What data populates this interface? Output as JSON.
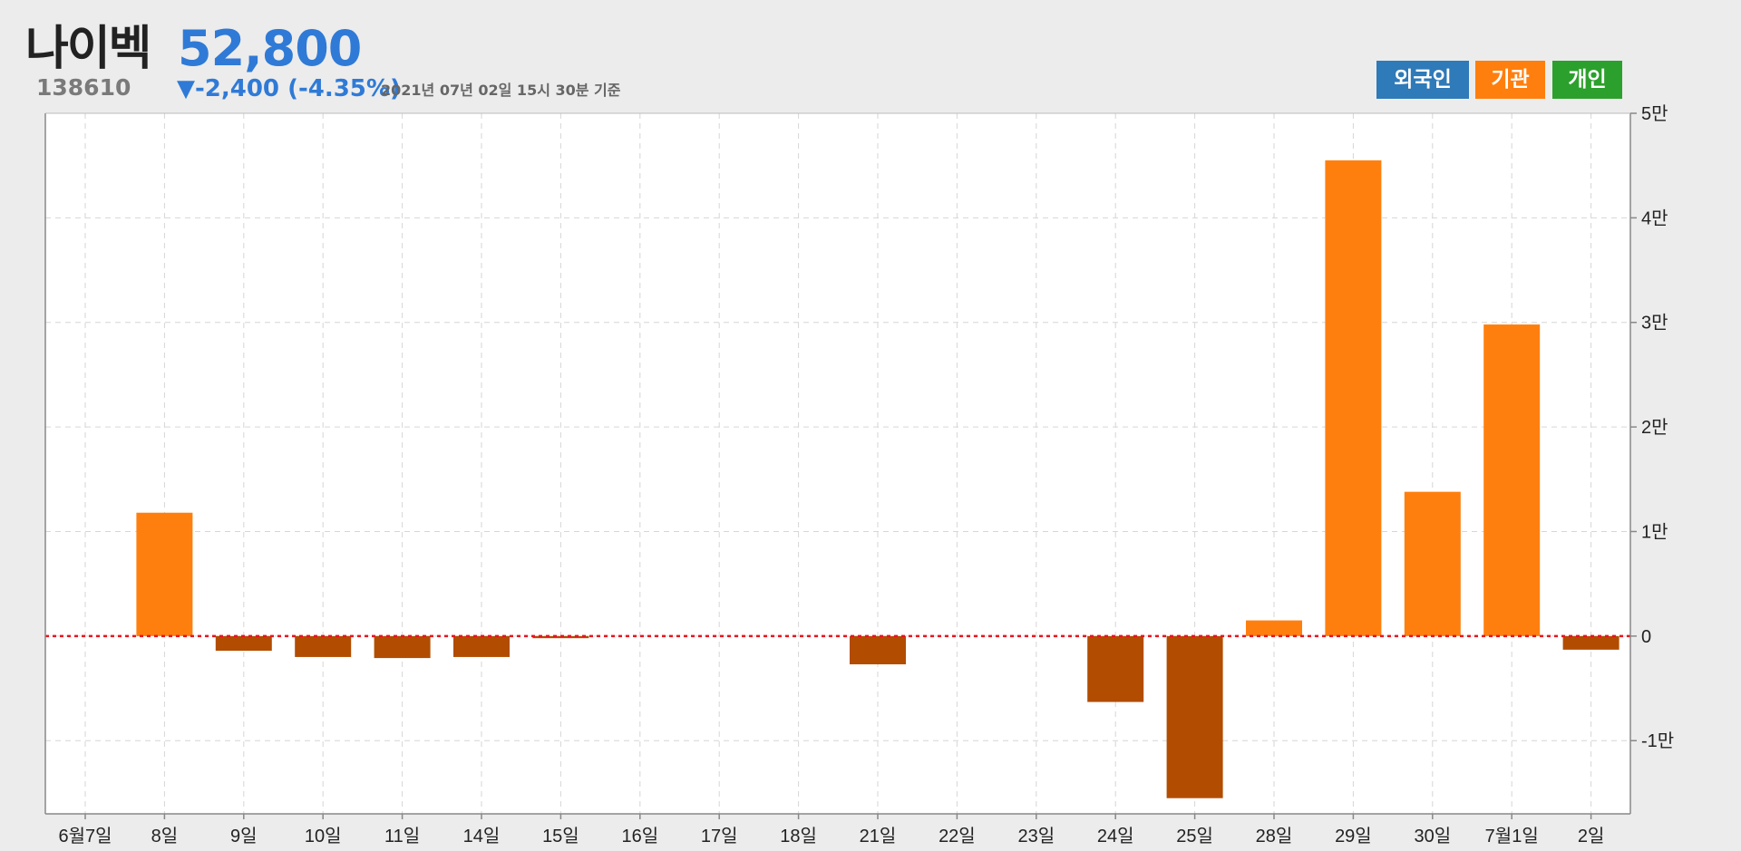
{
  "header": {
    "name": "나이벡",
    "price": "52,800",
    "code": "138610",
    "change": "▼-2,400 (-4.35%)",
    "timestamp": "2021년 07년 02일 15시 30분 기준"
  },
  "legend": {
    "foreign": "외국인",
    "institution": "기관",
    "individual": "개인"
  },
  "colors": {
    "positive": "#ff7f0e",
    "negative": "#b24c00",
    "foreign": "#2f7ab8",
    "individual": "#2ca02c",
    "zero_line": "#e8141e",
    "price": "#2f7ad6"
  },
  "chart_data": {
    "type": "bar",
    "categories": [
      "6월7일",
      "8일",
      "9일",
      "10일",
      "11일",
      "14일",
      "15일",
      "16일",
      "17일",
      "18일",
      "21일",
      "22일",
      "23일",
      "24일",
      "25일",
      "28일",
      "29일",
      "30일",
      "7월1일",
      "2일"
    ],
    "series": [
      {
        "values": [
          0,
          11800,
          -1400,
          -2000,
          -2100,
          -2000,
          -200,
          0,
          0,
          0,
          -2700,
          0,
          0,
          -6300,
          -15500,
          1500,
          45500,
          13800,
          29800,
          -1300
        ]
      }
    ],
    "ylim": [
      -17000,
      50000
    ],
    "yticks": [
      {
        "value": 50000,
        "label": "5만"
      },
      {
        "value": 40000,
        "label": "4만"
      },
      {
        "value": 30000,
        "label": "3만"
      },
      {
        "value": 20000,
        "label": "2만"
      },
      {
        "value": 10000,
        "label": "1만"
      },
      {
        "value": 0,
        "label": "0"
      },
      {
        "value": -10000,
        "label": "-1만"
      }
    ],
    "grid": true,
    "zero_line": "dotted-red"
  }
}
